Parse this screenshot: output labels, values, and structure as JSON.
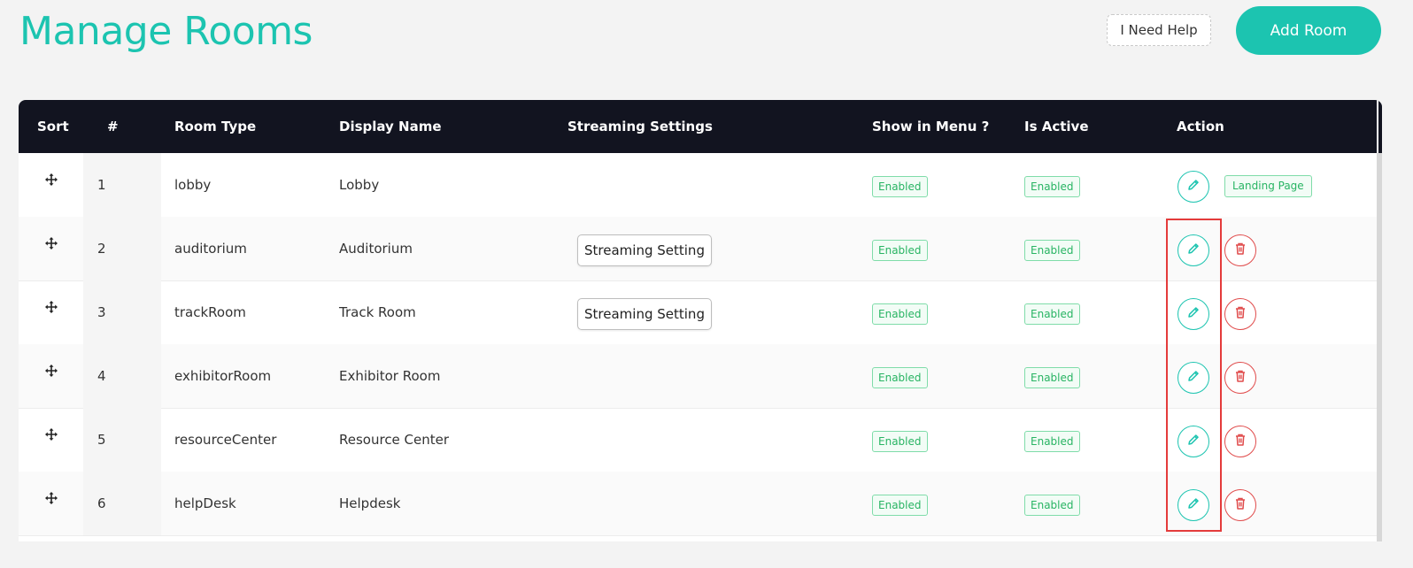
{
  "page": {
    "title": "Manage Rooms",
    "help_label": "I Need Help",
    "add_label": "Add Room"
  },
  "colors": {
    "accent": "#1cc4b0",
    "header_bg": "#121420",
    "badge_green": "#28b463",
    "danger": "#e04b4b",
    "highlight": "#e43b3b"
  },
  "table": {
    "headers": {
      "sort": "Sort",
      "num": "#",
      "room_type": "Room Type",
      "display_name": "Display Name",
      "streaming": "Streaming Settings",
      "show_in_menu": "Show in Menu ?",
      "is_active": "Is Active",
      "action": "Action"
    },
    "rows": [
      {
        "num": "1",
        "room_type": "lobby",
        "display_name": "Lobby",
        "streaming": "",
        "show_in_menu": "Enabled",
        "is_active": "Enabled",
        "landing": "Landing Page"
      },
      {
        "num": "2",
        "room_type": "auditorium",
        "display_name": "Auditorium",
        "streaming": "Streaming Setting",
        "show_in_menu": "Enabled",
        "is_active": "Enabled"
      },
      {
        "num": "3",
        "room_type": "trackRoom",
        "display_name": "Track Room",
        "streaming": "Streaming Setting",
        "show_in_menu": "Enabled",
        "is_active": "Enabled"
      },
      {
        "num": "4",
        "room_type": "exhibitorRoom",
        "display_name": "Exhibitor Room",
        "streaming": "",
        "show_in_menu": "Enabled",
        "is_active": "Enabled"
      },
      {
        "num": "5",
        "room_type": "resourceCenter",
        "display_name": "Resource Center",
        "streaming": "",
        "show_in_menu": "Enabled",
        "is_active": "Enabled"
      },
      {
        "num": "6",
        "room_type": "helpDesk",
        "display_name": "Helpdesk",
        "streaming": "",
        "show_in_menu": "Enabled",
        "is_active": "Enabled"
      }
    ]
  },
  "icons": {
    "sort": "move-icon",
    "edit": "pencil-icon",
    "delete": "trash-icon"
  }
}
